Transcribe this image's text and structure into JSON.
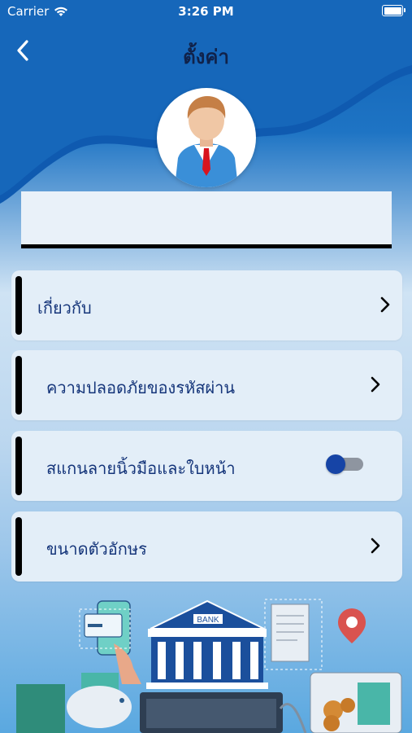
{
  "status_bar": {
    "carrier": "Carrier",
    "time": "3:26 PM"
  },
  "header": {
    "title": "ตั้งค่า"
  },
  "profile": {
    "name": ""
  },
  "menu": {
    "about": "เกี่ยวกับ",
    "password_security": "ความปลอดภัยของรหัสผ่าน",
    "biometric_scan": "สแกนลายนิ้วมือและใบหน้า",
    "font_size": "ขนาดตัวอักษร"
  },
  "biometric_toggle": {
    "state": "off"
  },
  "illustration": {
    "bank_sign": "BANK"
  },
  "colors": {
    "primary": "#0f5fb3",
    "menu_text": "#15357a",
    "title_text": "#10224a",
    "card_bg": "#e3eef8",
    "toggle_knob": "#1644a6"
  }
}
